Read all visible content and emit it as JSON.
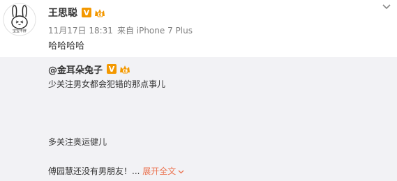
{
  "post": {
    "author": "王思聪",
    "verified_badge": "V",
    "timestamp": "11月17日 18:31",
    "source": "来自 iPhone 7 Plus",
    "text": "哈哈哈哈",
    "avatar_caption": "宝宝不胖"
  },
  "repost": {
    "author": "@金耳朵兔子",
    "verified_badge": "V",
    "lines": [
      "少关注男女都会犯错的那点事儿",
      "多关注奥运健儿",
      "傅园慧还没有男朋友！..."
    ],
    "expand_label": "展开全文"
  },
  "colors": {
    "vip_orange": "#f39800",
    "link_orange": "#eb7350",
    "repost_bg": "#f2f2f5",
    "meta_gray": "#808080"
  }
}
